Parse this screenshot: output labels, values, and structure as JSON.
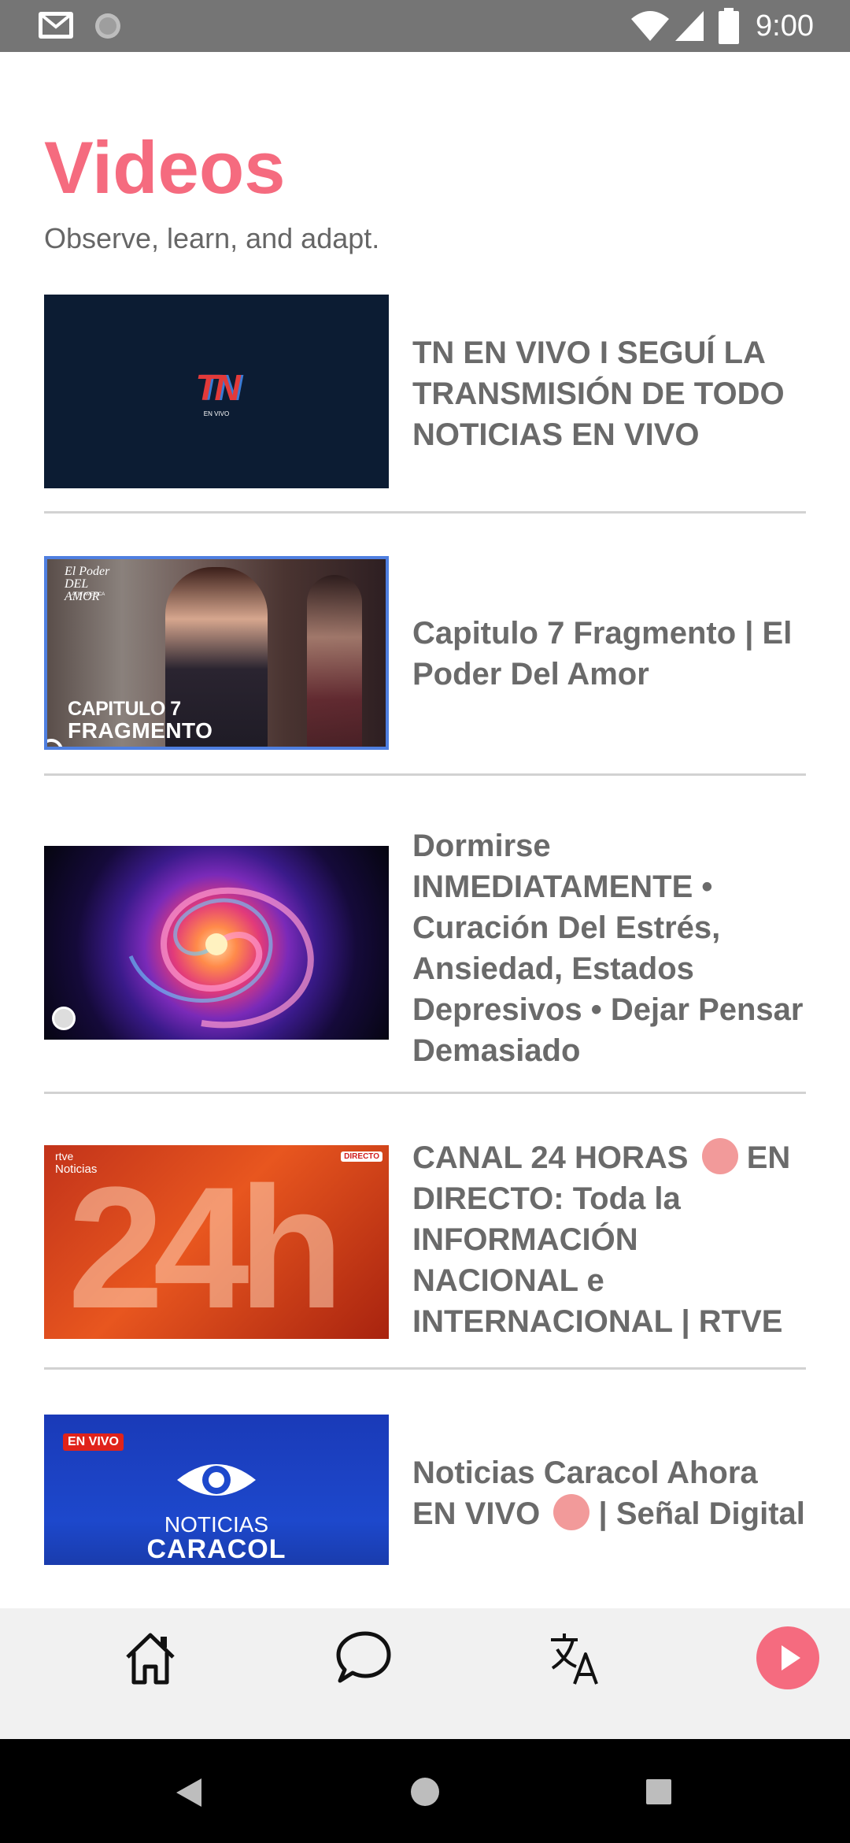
{
  "status_bar": {
    "time": "9:00",
    "icons": [
      "gmail-icon",
      "sync-icon",
      "wifi-icon",
      "cell-signal-icon",
      "battery-icon"
    ]
  },
  "header": {
    "title": "Videos",
    "subtitle": "Observe, learn, and adapt."
  },
  "videos": [
    {
      "title": "TN EN VIVO I SEGUÍ LA TRANSMISIÓN DE TODO NOTICIAS EN VIVO",
      "thumb": {
        "logo": "TN",
        "tag": "EN VIVO"
      }
    },
    {
      "title": "Capitulo 7 Fragmento | El Poder Del Amor",
      "thumb": {
        "brand": "El Poder DEL AMOR",
        "brand_sub": "LATIN AMERICA",
        "line1": "CAPITULO 7",
        "line2": "FRAGMENTO"
      }
    },
    {
      "title": "Dormirse INMEDIATAMENTE • Curación Del Estrés, Ansiedad, Estados Depresivos • Dejar Pensar Demasiado",
      "thumb": {}
    },
    {
      "title_before": "CANAL 24 HORAS",
      "title_after": "EN DIRECTO: Toda la INFORMACIÓN NACIONAL e INTERNACIONAL | RTVE",
      "thumb": {
        "brand": "rtve",
        "brand_sub": "Noticias",
        "badge": "DIRECTO",
        "big": "24h"
      }
    },
    {
      "title_before": "Noticias Caracol Ahora EN VIVO",
      "title_after": "| Señal Digital",
      "thumb": {
        "badge": "EN VIVO",
        "line1": "NOTICIAS",
        "line2": "CARACOL"
      }
    }
  ],
  "bottom_nav": {
    "items": [
      "home-icon",
      "chat-icon",
      "translate-icon",
      "play-icon"
    ],
    "accent": "#f56b7f"
  },
  "colors": {
    "accent": "#f56b7f",
    "status_bar": "#757575",
    "title_text": "#6a6a6a"
  }
}
